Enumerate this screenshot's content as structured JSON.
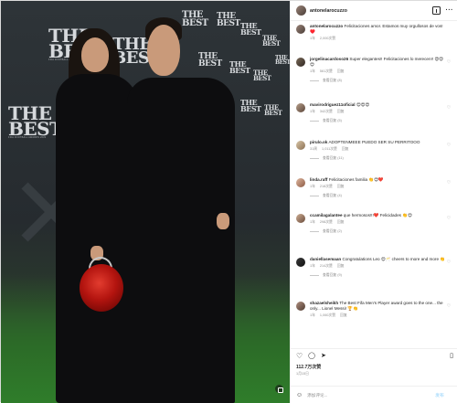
{
  "post": {
    "username": "antonelarocuzzo",
    "backdrop_logo": "THE BEST",
    "backdrop_sub": "FIFA FOOTBALL AWARDS 2022",
    "likes_label": "112.7万次赞",
    "date_label": "1月15日",
    "comment_placeholder": "添加评论...",
    "post_label": "发布",
    "more_label": "···"
  },
  "comments": [
    {
      "username": "antonelarocuzzo",
      "text": "Felicitaciones amor. Estamos muy orgullosos de vos!♥️",
      "meta": [
        "1年",
        "2,000次赞"
      ],
      "replies": ""
    },
    {
      "username": "jorgelinacardoso26",
      "text": "Super elegantes!! Felicitaciones lo merecen!! 😍😍😍",
      "meta": [
        "1年",
        "561次赞",
        "回复"
      ],
      "replies": "查看回复 (8)"
    },
    {
      "username": "mavirodriguez11oficial",
      "text": "😍😍😍",
      "meta": [
        "1年",
        "342次赞",
        "回复"
      ],
      "replies": "查看回复 (5)"
    },
    {
      "username": "pirulo.ok",
      "text": "ADOPTENMEEE PUEDO SER SU PERRITOOO",
      "meta": [
        "31周",
        "1,011次赞",
        "回复"
      ],
      "replies": "查看回复 (11)"
    },
    {
      "username": "linda.raff",
      "text": "Felicitaciones familia 👏😍❤️",
      "meta": [
        "1年",
        "218次赞",
        "回复"
      ],
      "replies": "查看回复 (4)"
    },
    {
      "username": "ccamilagalantee",
      "text": "que hermosos!!!❤️ Felicidades 👏😍",
      "meta": [
        "1年",
        "298次赞",
        "回复"
      ],
      "replies": "查看回复 (2)"
    },
    {
      "username": "daniellasemaan",
      "text": "Congratulations Leo 😍🥂 cheers to more and more 👏",
      "meta": [
        "1年",
        "214次赞",
        "回复"
      ],
      "replies": "查看回复 (9)"
    },
    {
      "username": "shazaelsheikh",
      "text": "The Best Fifa Men's Player award goes to the one... the only... Lionel Messi! 🏆👏",
      "meta": [
        "1年",
        "1,060次赞",
        "回复"
      ],
      "replies": ""
    }
  ],
  "icons": {
    "like": "heart-icon",
    "comment": "comment-icon",
    "share": "paper-plane-icon",
    "save": "bookmark-icon",
    "emoji": "smiley-icon",
    "carousel": "tag-icon"
  },
  "colors": {
    "backdrop": "#262b2f",
    "floor": "#2f7d2a",
    "rose": "#b3140f",
    "post_button": "#b2dffc"
  }
}
